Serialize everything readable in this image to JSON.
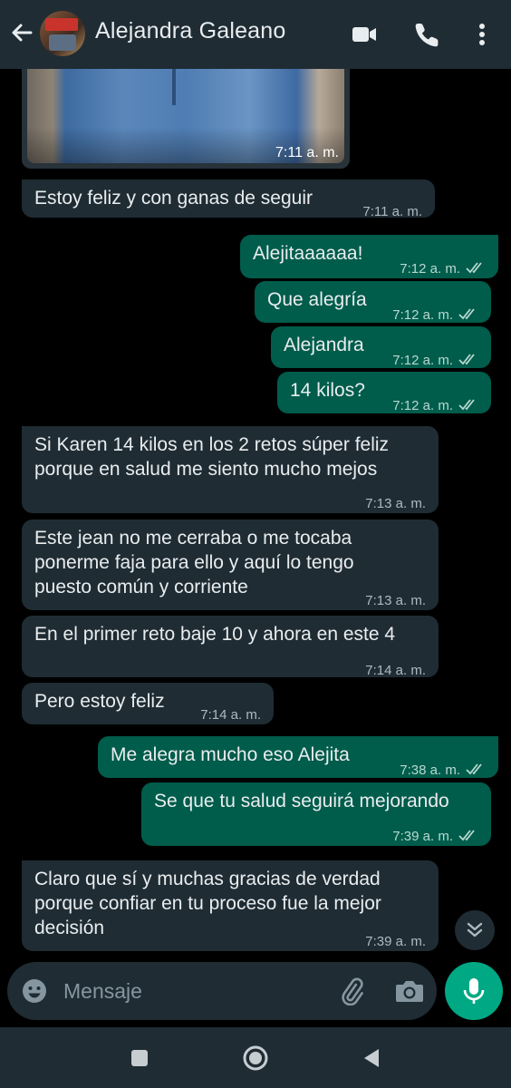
{
  "header": {
    "contact_name": "Alejandra Galeano",
    "icons": [
      "back-arrow-icon",
      "video-call-icon",
      "phone-icon",
      "more-options-icon"
    ]
  },
  "photo_message": {
    "time": "7:11 a. m."
  },
  "messages": [
    {
      "dir": "in",
      "text": "Estoy feliz y con ganas de seguir",
      "time": "7:11 a. m."
    },
    {
      "dir": "out",
      "text": "Alejitaaaaaa!",
      "time": "7:12 a. m."
    },
    {
      "dir": "out",
      "text": "Que alegría",
      "time": "7:12 a. m."
    },
    {
      "dir": "out",
      "text": "Alejandra",
      "time": "7:12 a. m."
    },
    {
      "dir": "out",
      "text": "14 kilos?",
      "time": "7:12 a. m."
    },
    {
      "dir": "in",
      "text": "Si Karen 14 kilos en los 2 retos súper feliz\nporque en salud me siento mucho mejos",
      "time": "7:13 a. m."
    },
    {
      "dir": "in",
      "text": "Este jean no me cerraba o me tocaba\nponerme faja para ello y aquí lo tengo\npuesto común y corriente",
      "time": "7:13 a. m."
    },
    {
      "dir": "in",
      "text": "En el primer reto baje 10 y ahora en este 4",
      "time": "7:14 a. m."
    },
    {
      "dir": "in",
      "text": "Pero estoy feliz",
      "time": "7:14 a. m."
    },
    {
      "dir": "out",
      "text": "Me alegra mucho eso Alejita",
      "time": "7:38 a. m."
    },
    {
      "dir": "out",
      "text": "Se que tu salud seguirá mejorando",
      "time": "7:39 a. m."
    },
    {
      "dir": "in",
      "text": "Claro que sí y muchas gracias de verdad\nporque confiar en tu proceso fue la mejor\ndecisión",
      "time": "7:39 a. m."
    }
  ],
  "composer": {
    "placeholder": "Mensaje",
    "icons": [
      "emoji-icon",
      "attach-icon",
      "camera-icon",
      "mic-icon"
    ]
  },
  "colors": {
    "header_bg": "#1f2c34",
    "incoming_bubble": "#1f2c34",
    "outgoing_bubble": "#005c4b",
    "accent": "#00a884",
    "read_ticks": "#aebac1"
  }
}
